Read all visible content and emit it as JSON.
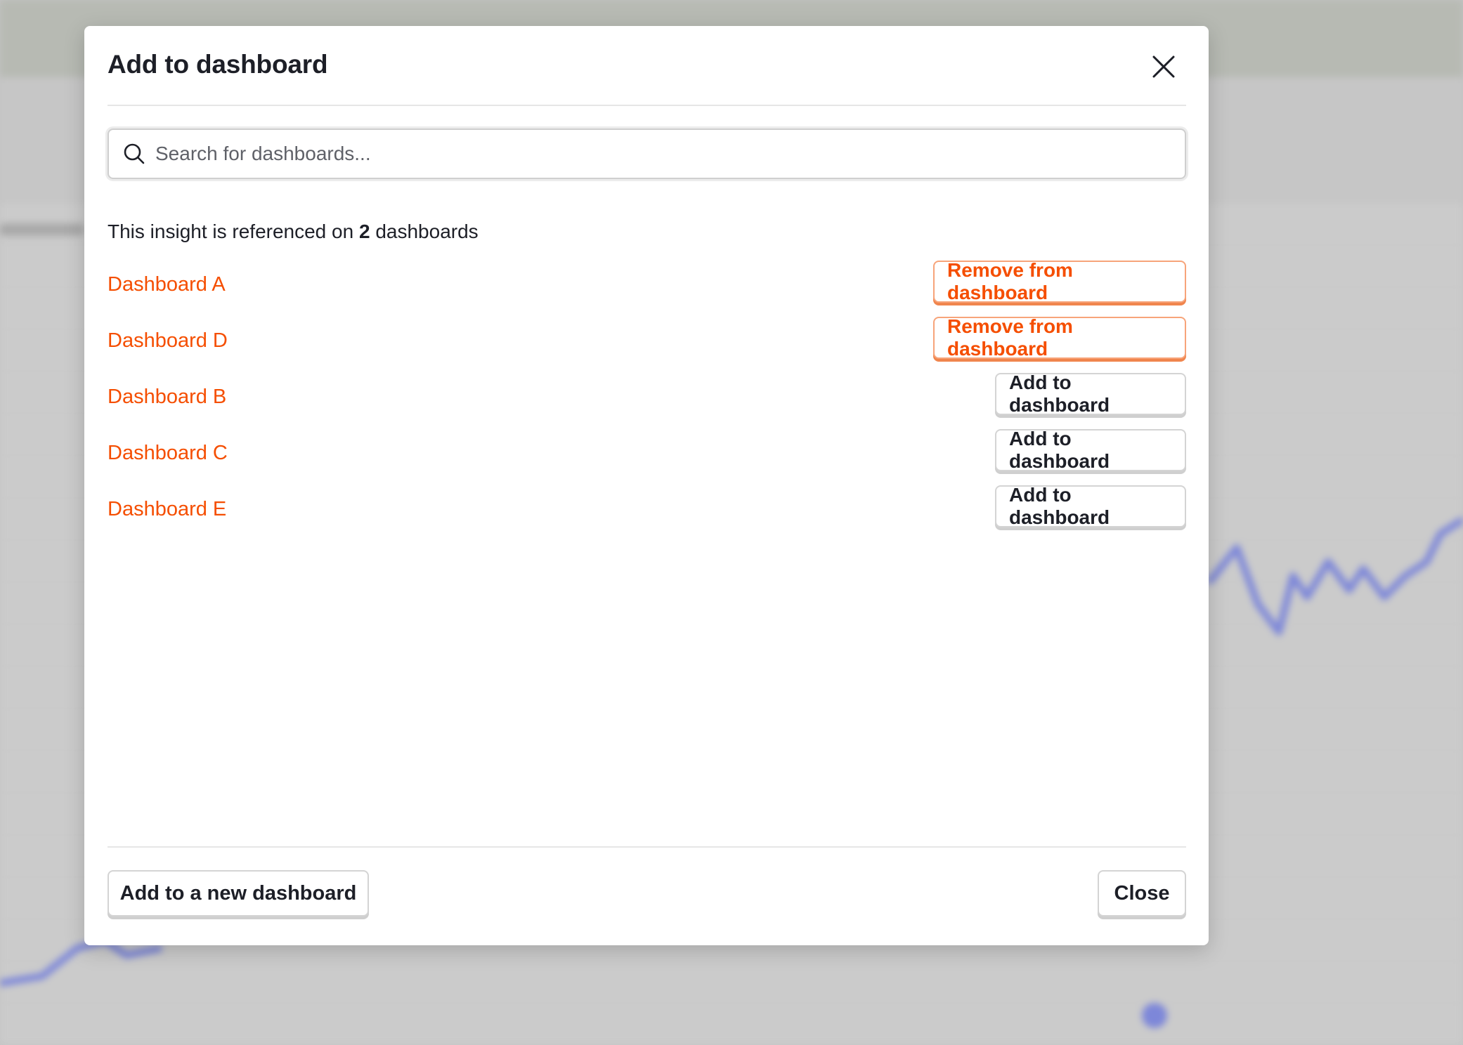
{
  "modal": {
    "title": "Add to dashboard",
    "search": {
      "placeholder": "Search for dashboards...",
      "value": ""
    },
    "reference": {
      "prefix": "This insight is referenced on",
      "count": "2",
      "suffix": "dashboards"
    },
    "dashboards": [
      {
        "name": "Dashboard A",
        "action": "Remove from dashboard",
        "on_dashboard": true
      },
      {
        "name": "Dashboard D",
        "action": "Remove from dashboard",
        "on_dashboard": true
      },
      {
        "name": "Dashboard B",
        "action": "Add to dashboard",
        "on_dashboard": false
      },
      {
        "name": "Dashboard C",
        "action": "Add to dashboard",
        "on_dashboard": false
      },
      {
        "name": "Dashboard E",
        "action": "Add to dashboard",
        "on_dashboard": false
      }
    ],
    "footer": {
      "new_dashboard_label": "Add to a new dashboard",
      "close_label": "Close"
    },
    "icons": {
      "close": "close-icon",
      "search": "search-icon"
    }
  },
  "colors": {
    "accent": "#f54e00",
    "text": "#1d1f27",
    "backdrop": "#c9c9c9",
    "chart_line": "#7d87d9"
  }
}
